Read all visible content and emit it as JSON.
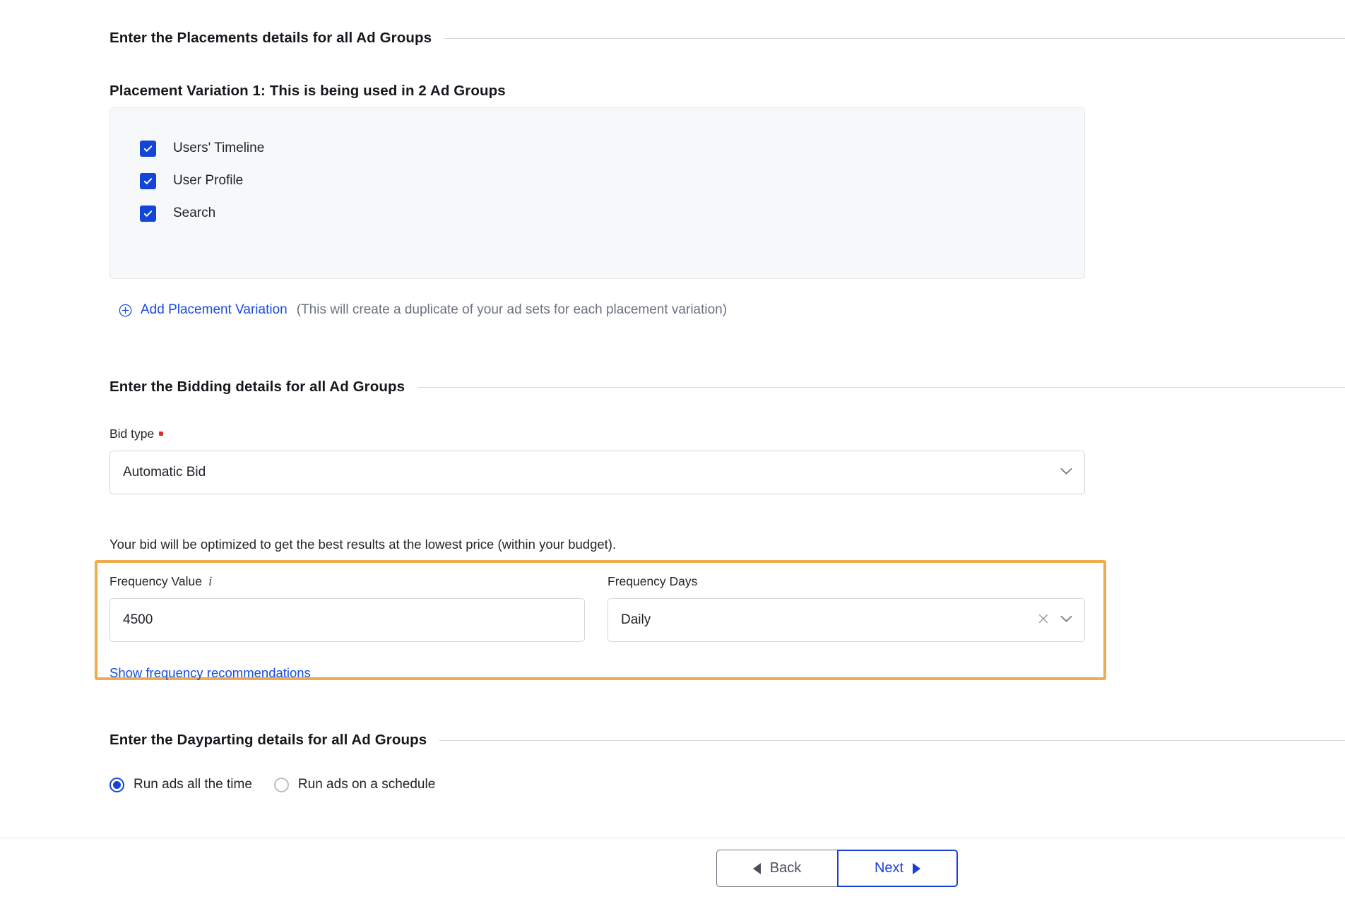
{
  "placements": {
    "section_title": "Enter the Placements details for all Ad Groups",
    "variation_heading": "Placement Variation 1: This is being used in 2 Ad Groups",
    "options": [
      {
        "label": "Users' Timeline",
        "checked": true,
        "icon": "checkbox-checked-icon"
      },
      {
        "label": "User Profile",
        "checked": true,
        "icon": "checkbox-checked-icon"
      },
      {
        "label": "Search",
        "checked": true,
        "icon": "checkbox-checked-icon"
      }
    ],
    "add_variation_icon": "plus-circle-icon",
    "add_variation_label": "Add Placement Variation",
    "add_variation_note": "(This will create a duplicate of your ad sets for each placement variation)"
  },
  "bidding": {
    "section_title": "Enter the Bidding details for all Ad Groups",
    "bid_type_label": "Bid type",
    "bid_type_required": true,
    "bid_type_value": "Automatic Bid",
    "bid_type_chevron_icon": "chevron-down-icon",
    "bid_type_options": [
      "Automatic Bid"
    ],
    "bid_helper_text": "Your bid will be optimized to get the best results at the lowest price (within your budget).",
    "frequency_value_label": "Frequency Value",
    "frequency_value_info_icon": "info-icon",
    "frequency_value": "4500",
    "frequency_value_placeholder": "",
    "frequency_days_label": "Frequency Days",
    "frequency_days_value": "Daily",
    "frequency_days_options": [
      "Daily"
    ],
    "frequency_days_clear_icon": "close-icon",
    "frequency_days_chevron_icon": "chevron-down-icon",
    "show_recommendations_label": "Show frequency recommendations",
    "highlight_color": "#efac4e"
  },
  "dayparting": {
    "section_title": "Enter the Dayparting details for all Ad Groups",
    "options": [
      {
        "label": "Run ads all the time",
        "selected": true
      },
      {
        "label": "Run ads on a schedule",
        "selected": false
      }
    ]
  },
  "footer": {
    "back_label": "Back",
    "back_icon": "triangle-left-icon",
    "next_label": "Next",
    "next_icon": "triangle-right-icon"
  },
  "colors": {
    "accent_blue": "#1346d6",
    "link_blue": "#1a4bdc",
    "highlight_orange": "#efac4e",
    "required_red": "#d93025"
  }
}
